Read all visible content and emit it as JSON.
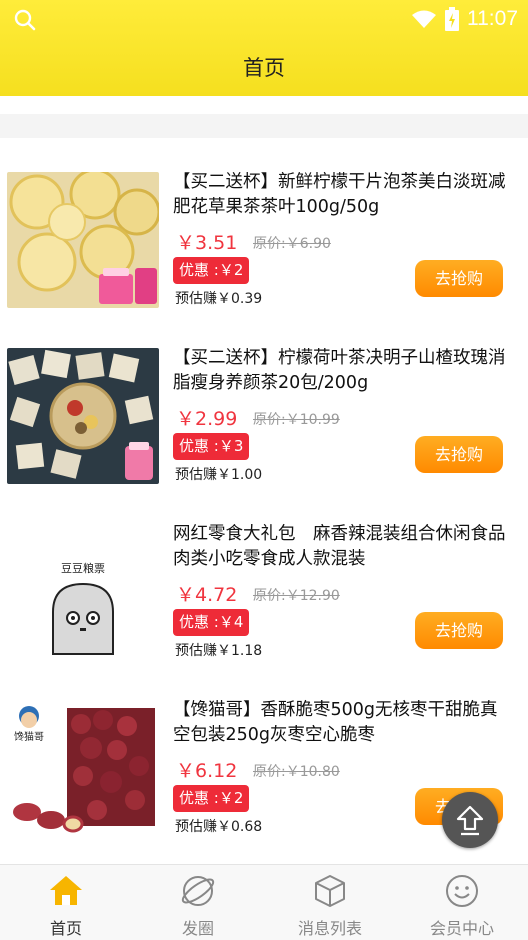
{
  "status_bar": {
    "time": "11:07"
  },
  "header": {
    "title": "首页"
  },
  "products": [
    {
      "title": "【买二送杯】新鲜柠檬干片泡茶美白淡斑减肥花草果茶茶叶100g/50g",
      "price": "￥3.51",
      "original_price": "原价:￥6.90",
      "coupon": "优惠 :￥2",
      "earn": "预估赚￥0.39",
      "buy_label": "去抢购",
      "image": "lemon-slices"
    },
    {
      "title": "【买二送杯】柠檬荷叶茶决明子山楂玫瑰消脂瘦身养颜茶20包/200g",
      "price": "￥2.99",
      "original_price": "原价:￥10.99",
      "coupon": "优惠 :￥3",
      "earn": "预估赚￥1.00",
      "buy_label": "去抢购",
      "image": "tea-bags"
    },
    {
      "title": "网红零食大礼包　麻香辣混装组合休闲食品 肉类小吃零食成人款混装",
      "price": "￥4.72",
      "original_price": "原价:￥12.90",
      "coupon": "优惠 :￥4",
      "earn": "预估赚￥1.18",
      "buy_label": "去抢购",
      "image": "snack-mascot",
      "image_text": "豆豆粮票"
    },
    {
      "title": "【馋猫哥】香酥脆枣500g无核枣干甜脆真空包装250g灰枣空心脆枣",
      "price": "￥6.12",
      "original_price": "原价:￥10.80",
      "coupon": "优惠 :￥2",
      "earn": "预估赚￥0.68",
      "buy_label": "去抢购",
      "image": "jujube",
      "image_text": "馋猫哥"
    }
  ],
  "tabs": [
    {
      "label": "首页",
      "icon": "home-icon",
      "active": true
    },
    {
      "label": "发圈",
      "icon": "planet-icon",
      "active": false
    },
    {
      "label": "消息列表",
      "icon": "box-icon",
      "active": false
    },
    {
      "label": "会员中心",
      "icon": "smiley-icon",
      "active": false
    }
  ],
  "colors": {
    "header": "#f5df1f",
    "price": "#f0353f",
    "coupon": "#ee2b38",
    "buy_button": "#ff9a10"
  }
}
